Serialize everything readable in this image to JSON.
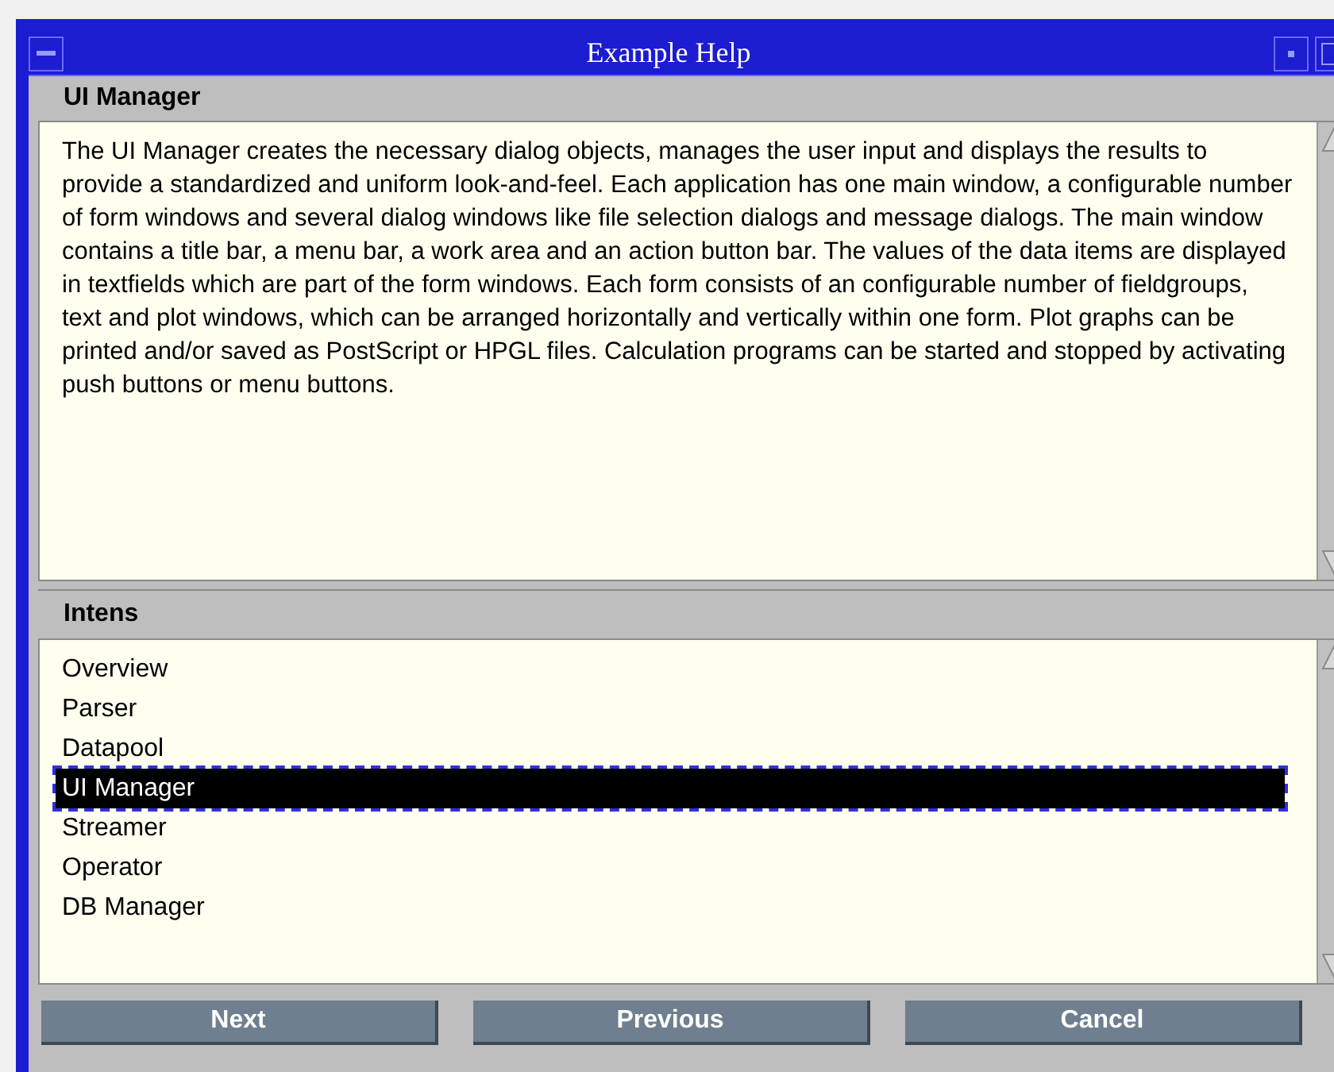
{
  "window": {
    "title": "Example Help"
  },
  "topic": {
    "heading": "UI Manager",
    "text": "The UI Manager creates the necessary dialog objects, manages the user input and displays the results to provide a standardized and uniform look-and-feel. Each application has one main window, a configurable number of form windows and several dialog windows like file selection dialogs and message dialogs. The main window contains a title bar, a menu bar, a work area and an action button bar. The values of the data items are displayed in textfields which are part of the form windows. Each form consists of an configurable number of fieldgroups, text and plot windows, which can be arranged horizontally and vertically within one form. Plot graphs can be printed and/or saved as PostScript or HPGL files. Calculation programs can be started and stopped by activating push buttons or menu buttons."
  },
  "index": {
    "heading": "Intens",
    "items": [
      {
        "label": "Overview",
        "selected": false
      },
      {
        "label": "Parser",
        "selected": false
      },
      {
        "label": "Datapool",
        "selected": false
      },
      {
        "label": "UI Manager",
        "selected": true
      },
      {
        "label": "Streamer",
        "selected": false
      },
      {
        "label": "Operator",
        "selected": false
      },
      {
        "label": "DB Manager",
        "selected": false
      }
    ]
  },
  "buttons": [
    "Next",
    "Previous",
    "Cancel"
  ]
}
